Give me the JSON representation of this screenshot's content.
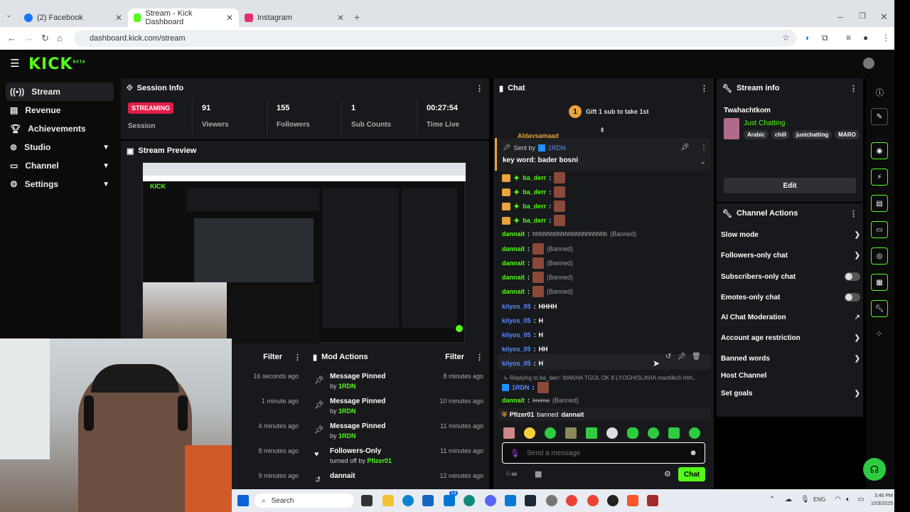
{
  "browser": {
    "tabs": [
      {
        "title": "(2) Facebook",
        "color": "#1877f2"
      },
      {
        "title": "Stream - Kick Dashboard",
        "color": "#53fc18"
      },
      {
        "title": "Instagram",
        "color": "#e1306c"
      }
    ],
    "url": "dashboard.kick.com/stream"
  },
  "app": {
    "logo": "KICK",
    "logo_sup": "BETA"
  },
  "sidebar": {
    "items": [
      {
        "label": "Stream",
        "icon": "broadcast-icon"
      },
      {
        "label": "Revenue",
        "icon": "revenue-icon"
      },
      {
        "label": "Achievements",
        "icon": "trophy-icon"
      },
      {
        "label": "Studio",
        "icon": "studio-icon"
      },
      {
        "label": "Channel",
        "icon": "channel-icon"
      },
      {
        "label": "Settings",
        "icon": "gear-icon"
      }
    ]
  },
  "session": {
    "title": "Session Info",
    "status": "STREAMING",
    "status_label": "Session",
    "stats": [
      {
        "value": "91",
        "label": "Viewers"
      },
      {
        "value": "155",
        "label": "Followers"
      },
      {
        "value": "1",
        "label": "Sub Counts"
      },
      {
        "value": "00:27:54",
        "label": "Time Live"
      }
    ]
  },
  "preview": {
    "title": "Stream Preview"
  },
  "activity": {
    "filter": "Filter",
    "times": [
      "16 seconds ago",
      "1 minute ago",
      "4 minutes ago",
      "8 minutes ago",
      "9 minutes ago"
    ]
  },
  "mod_actions": {
    "title": "Mod Actions",
    "filter": "Filter",
    "rows": [
      {
        "title": "Message Pinned",
        "by_prefix": "by",
        "by": "1RDN",
        "time": "8 minutes ago",
        "icon": "pin-icon"
      },
      {
        "title": "Message Pinned",
        "by_prefix": "by",
        "by": "1RDN",
        "time": "10 minutes ago",
        "icon": "pin-icon"
      },
      {
        "title": "Message Pinned",
        "by_prefix": "by",
        "by": "1RDN",
        "time": "11 minutes ago",
        "icon": "pin-icon"
      },
      {
        "title": "Followers-Only",
        "by_prefix": "turned off by",
        "by": "Pfizer01",
        "time": "11 minutes ago",
        "icon": "heart-icon"
      },
      {
        "title": "dannait",
        "by_prefix": "",
        "by": "",
        "time": "12 minutes ago",
        "icon": "undo-icon"
      }
    ]
  },
  "chat": {
    "title": "Chat",
    "gift_text": "Gift 1 sub to take 1st",
    "gift_count": "1",
    "pinned_sent_by": "Sent by",
    "pinned_user": "1RDN",
    "pinned_text": "key word: bader bosni",
    "partial_user": "Aldaysamaad",
    "messages": [
      {
        "user": "ba_derr",
        "text": "",
        "banned": ""
      },
      {
        "user": "ba_derr",
        "text": "",
        "banned": ""
      },
      {
        "user": "ba_derr",
        "text": "",
        "banned": ""
      },
      {
        "user": "ba_derr",
        "text": "",
        "banned": ""
      },
      {
        "user": "dannait",
        "text": "hhhhhhhhhhhhhhhhhhhhh",
        "banned": "(Banned)"
      },
      {
        "user": "dannait",
        "text": "",
        "banned": "(Banned)"
      },
      {
        "user": "dannait",
        "text": "",
        "banned": "(Banned)"
      },
      {
        "user": "dannait",
        "text": "",
        "banned": "(Banned)"
      },
      {
        "user": "dannait",
        "text": "",
        "banned": "(Banned)"
      },
      {
        "user": "kilyos_05",
        "text": "HHHH",
        "banned": ""
      },
      {
        "user": "kilyos_05",
        "text": "H",
        "banned": ""
      },
      {
        "user": "kilyos_05",
        "text": "H",
        "banned": ""
      },
      {
        "user": "kilyos_05",
        "text": "HH",
        "banned": ""
      },
      {
        "user": "kilyos_05",
        "text": "H",
        "banned": ""
      }
    ],
    "reply_text": "Replying to ba_derr: WAKHA TGOL OK 8 LYOGHISLAVIA mantilkch hhh...",
    "reply_user": "1RDN",
    "strike_user": "dannait",
    "strike_text": "lmima",
    "strike_banned": "(Banned)",
    "system_mod": "Pfizer01",
    "system_text": "banned",
    "system_target": "dannait",
    "input_placeholder": "Send a message",
    "send_label": "Chat"
  },
  "stream_info": {
    "title": "Stream info",
    "channel": "Twahachtkom",
    "category": "Just Chatting",
    "tags": [
      "Arabic",
      "chill",
      "justchatting",
      "MARO"
    ],
    "edit_label": "Edit"
  },
  "channel_actions": {
    "title": "Channel Actions",
    "items": [
      {
        "label": "Slow mode",
        "type": "chevron"
      },
      {
        "label": "Followers-only chat",
        "type": "chevron"
      },
      {
        "label": "Subscribers-only chat",
        "type": "toggle"
      },
      {
        "label": "Emotes-only chat",
        "type": "toggle"
      },
      {
        "label": "AI Chat Moderation",
        "type": "external"
      },
      {
        "label": "Account age restriction",
        "type": "chevron"
      },
      {
        "label": "Banned words",
        "type": "chevron"
      },
      {
        "label": "Host Channel",
        "type": "none"
      },
      {
        "label": "Set goals",
        "type": "chevron"
      }
    ]
  },
  "taskbar": {
    "search": "Search",
    "lang": "ENG",
    "time": "3:46 PM",
    "date": "10/3/2025",
    "badge": "13"
  },
  "colors": {
    "accent": "#53fc18",
    "panel": "#18191c",
    "live": "#e11d48"
  }
}
